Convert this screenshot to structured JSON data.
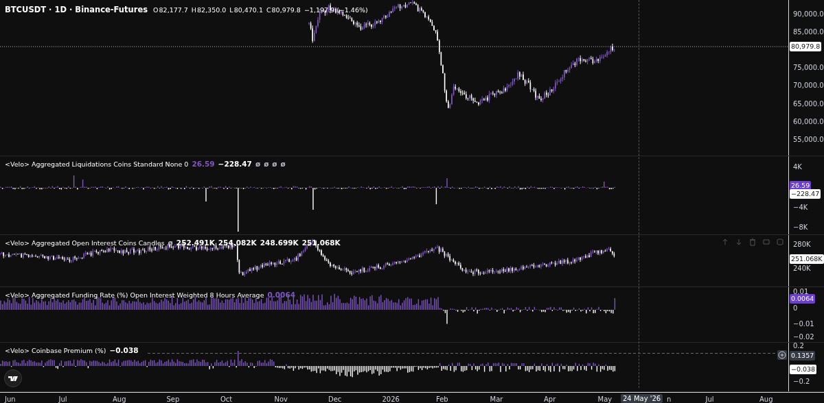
{
  "header": {
    "symbol": "BTCUSDT · 1D · Binance-Futures",
    "ohlc": [
      {
        "label": "O",
        "value": "82,177.7"
      },
      {
        "label": "H",
        "value": "82,350.0"
      },
      {
        "label": "L",
        "value": "80,470.1"
      },
      {
        "label": "C",
        "value": "80,979.8"
      }
    ],
    "change": "−1,197.9 (−1.46%)"
  },
  "price_axis": {
    "ticks": [
      "90,000.0",
      "85,000.0",
      "75,000.0",
      "70,000.0",
      "65,000.0",
      "60,000.0",
      "55,000.0"
    ],
    "last_price": "80,979.8"
  },
  "panes": [
    {
      "kind": "liquidations",
      "title": "<Velo> Aggregated Liquidations Coins Standard None 0",
      "values": [
        {
          "text": "26.59",
          "color": "#7e57c2"
        },
        {
          "text": "−228.47",
          "color": "#ffffff"
        },
        {
          "text": "ø",
          "color": "#b2b5be"
        },
        {
          "text": "ø",
          "color": "#b2b5be"
        },
        {
          "text": "ø",
          "color": "#b2b5be"
        },
        {
          "text": "ø",
          "color": "#b2b5be"
        }
      ],
      "ticks": [
        "4K",
        "−4K",
        "−8K"
      ],
      "tags": [
        {
          "text": "26.59",
          "color": "#6a3fd0"
        },
        {
          "text": "−228.47",
          "color": "#ffffff"
        }
      ]
    },
    {
      "kind": "open_interest",
      "title": "<Velo> Aggregated Open Interest Coins Candles",
      "values": [
        {
          "text": "ø",
          "color": "#b2b5be"
        },
        {
          "text": "252.491K",
          "color": "#ffffff"
        },
        {
          "text": "254.082K",
          "color": "#ffffff"
        },
        {
          "text": "248.699K",
          "color": "#ffffff"
        },
        {
          "text": "251.068K",
          "color": "#ffffff"
        }
      ],
      "ticks": [
        "280K",
        "240K"
      ],
      "tags": [
        {
          "text": "251.068K",
          "color": "#ffffff"
        }
      ]
    },
    {
      "kind": "funding",
      "title": "<Velo> Aggregated Funding Rate (%) Open Interest Weighted 8 Hours Average",
      "values": [
        {
          "text": "0.0064",
          "color": "#7e57c2"
        }
      ],
      "ticks": [
        "0.01",
        "0",
        "−0.01",
        "−0.02"
      ],
      "tags": [
        {
          "text": "0.0064",
          "color": "#6a3fd0"
        }
      ]
    },
    {
      "kind": "premium",
      "title": "<Velo> Coinbase Premium (%)",
      "values": [
        {
          "text": "−0.038",
          "color": "#ffffff"
        }
      ],
      "ticks": [
        "0.2",
        "−0.2"
      ],
      "tags": [
        {
          "text": "0.1357",
          "color": "#363a45"
        },
        {
          "text": "−0.038",
          "color": "#ffffff"
        }
      ]
    }
  ],
  "time_axis": {
    "ticks": [
      {
        "label": "Jun"
      },
      {
        "label": "Jul"
      },
      {
        "label": "Aug"
      },
      {
        "label": "Sep"
      },
      {
        "label": "Oct"
      },
      {
        "label": "Nov"
      },
      {
        "label": "Dec"
      },
      {
        "label": "2026"
      },
      {
        "label": "Feb"
      },
      {
        "label": "Mar"
      },
      {
        "label": "Apr"
      },
      {
        "label": "May"
      },
      {
        "label": "n",
        "partial": true
      },
      {
        "label": "Jul"
      },
      {
        "label": "Aug"
      }
    ],
    "crosshair_date": "24 May '26"
  }
}
